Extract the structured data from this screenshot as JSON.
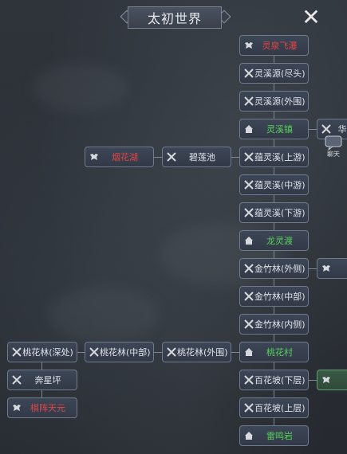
{
  "title": "太初世界",
  "close_label": "✕",
  "chat_label": "聊天",
  "nodes": {
    "lingquan": "灵泉飞瀑",
    "lingxi_end": "灵溪源(尽头)",
    "lingxi_out": "灵溪源(外围)",
    "lingxi_town": "灵溪镇",
    "partial_right_1": "华",
    "yunling_up": "蕴灵溪(上游)",
    "bilian": "碧莲池",
    "yanhua": "烟花湖",
    "yunling_mid": "蕴灵溪(中游)",
    "yunling_down": "蕴灵溪(下游)",
    "longling": "龙灵渡",
    "jinzhu_out": "金竹林(外侧)",
    "jinzhu_mid": "金竹林(中部)",
    "jinzhu_in": "金竹林(内侧)",
    "taohua_deep": "桃花林(深处)",
    "taohua_mid": "桃花林(中部)",
    "taohua_out": "桃花林(外围)",
    "taohua_village": "桃花村",
    "baihua_down": "百花坡(下层)",
    "benxing": "奔星坪",
    "baihua_up": "百花坡(上层)",
    "qizhen": "棋阵天元",
    "leiming": "雷鸣岩"
  }
}
